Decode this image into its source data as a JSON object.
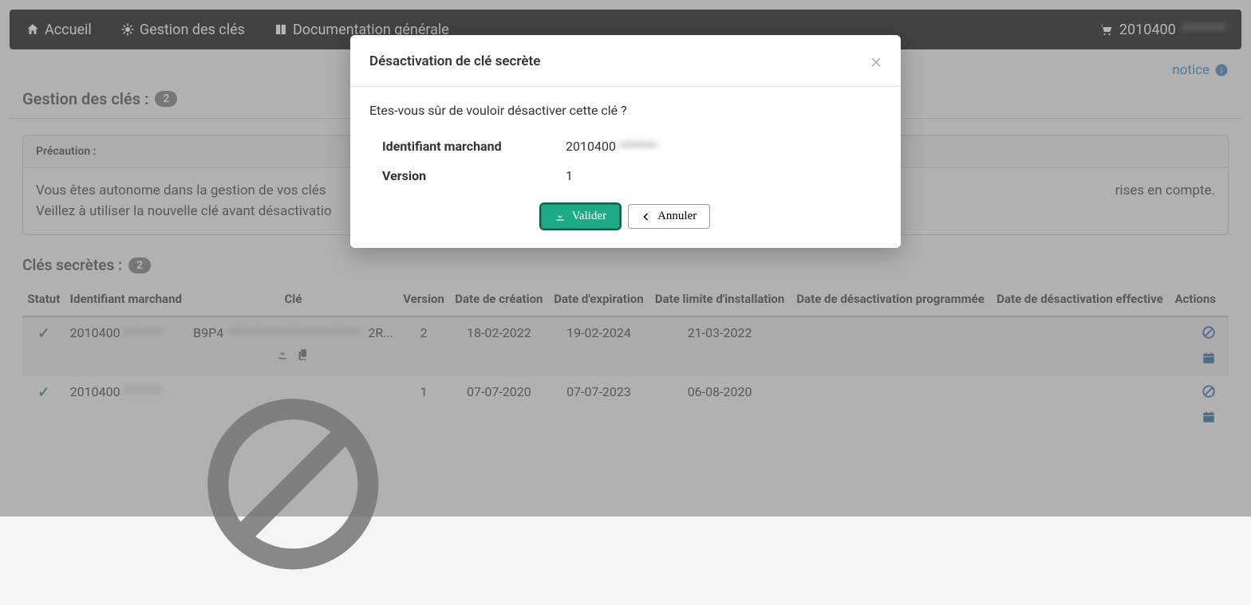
{
  "nav": {
    "home": "Accueil",
    "keys": "Gestion des clés",
    "docs": "Documentation générale",
    "merchant_prefix": "2010400",
    "merchant_hidden": "*******"
  },
  "notice": "notice",
  "section": {
    "title": "Gestion des clés :",
    "count": "2"
  },
  "precaution": {
    "title": "Précaution :",
    "line1": "Vous êtes autonome dans la gestion de vos clés",
    "line1b": "rises en compte.",
    "line2": "Veillez à utiliser la nouvelle clé avant désactivatio"
  },
  "section_keys": {
    "title": "Clés secrètes :",
    "count": "2"
  },
  "table": {
    "headers": {
      "status": "Statut",
      "merchant": "Identifiant marchand",
      "key": "Clé",
      "version": "Version",
      "created": "Date de création",
      "expires": "Date d'expiration",
      "install_limit": "Date limite d'installation",
      "deact_prog": "Date de désactivation programmée",
      "deact_eff": "Date de désactivation effective",
      "actions": "Actions"
    },
    "rows": [
      {
        "merchant_prefix": "2010400",
        "merchant_hidden": "*******",
        "key_prefix": "B9P4",
        "key_hidden": "************************",
        "key_suffix": "2R...",
        "version": "2",
        "created": "18-02-2022",
        "expires": "19-02-2024",
        "install_limit": "21-03-2022",
        "deact_prog": "",
        "deact_eff": ""
      },
      {
        "merchant_prefix": "2010400",
        "merchant_hidden": "*******",
        "version": "1",
        "created": "07-07-2020",
        "expires": "07-07-2023",
        "install_limit": "06-08-2020",
        "deact_prog": "",
        "deact_eff": ""
      }
    ]
  },
  "modal": {
    "title": "Désactivation de clé secrète",
    "question": "Etes-vous sûr de vouloir désactiver cette clé ?",
    "label_merchant": "Identifiant marchand",
    "merchant_prefix": "2010400",
    "merchant_hidden": "*******",
    "label_version": "Version",
    "version": "1",
    "validate": "Valider",
    "cancel": "Annuler"
  }
}
